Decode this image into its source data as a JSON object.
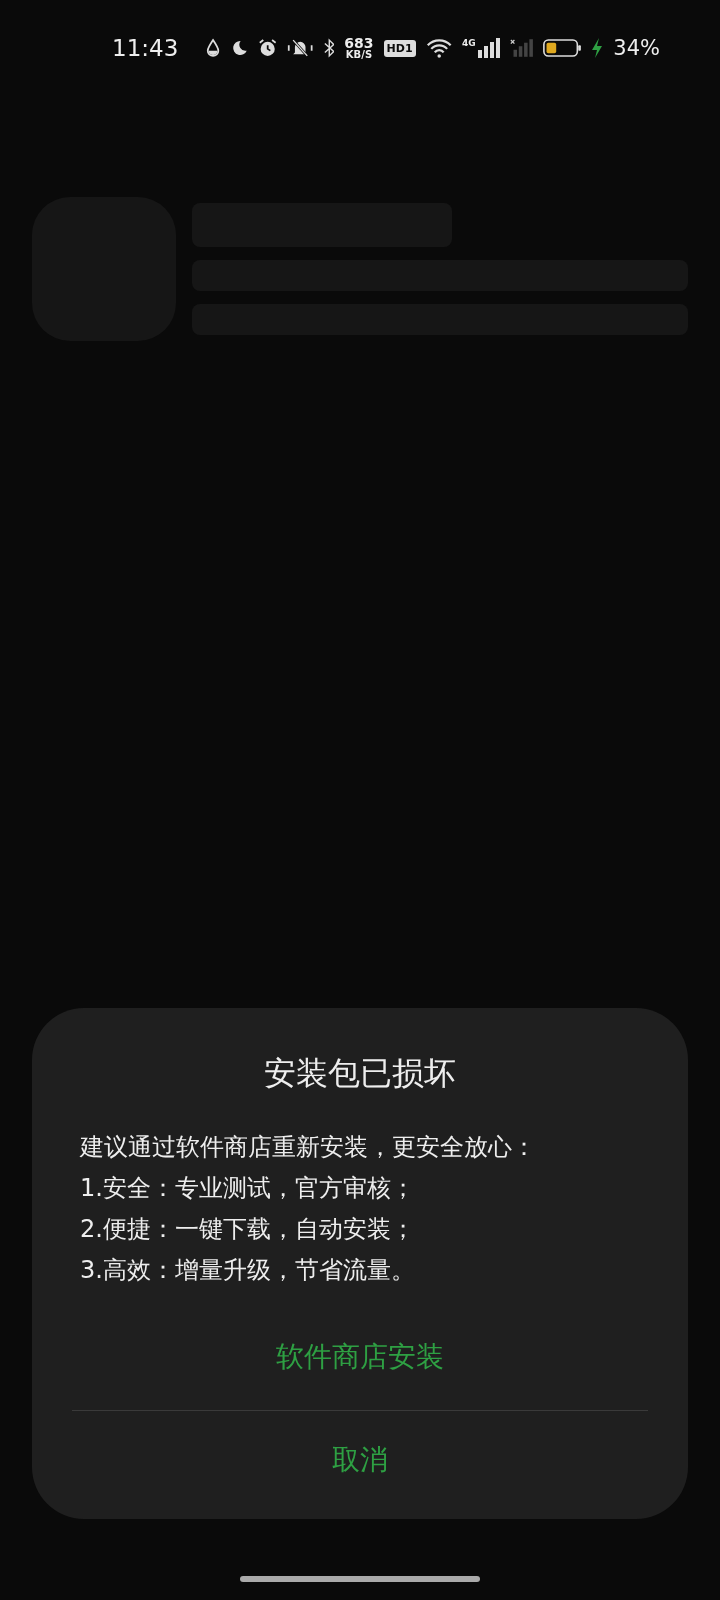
{
  "status_bar": {
    "time": "11:43",
    "net_speed_value": "683",
    "net_speed_unit": "KB/S",
    "hd_badge": "HD1",
    "network_type": "4G",
    "battery_percent": "34%",
    "charging": true
  },
  "dialog": {
    "title": "安装包已损坏",
    "body_lines": [
      "建议通过软件商店重新安装，更安全放心：",
      "1.安全：专业测试，官方审核；",
      "2.便捷：一键下载，自动安装；",
      "3.高效：增量升级，节省流量。"
    ],
    "buttons": [
      {
        "label": "软件商店安装"
      },
      {
        "label": "取消"
      }
    ]
  }
}
